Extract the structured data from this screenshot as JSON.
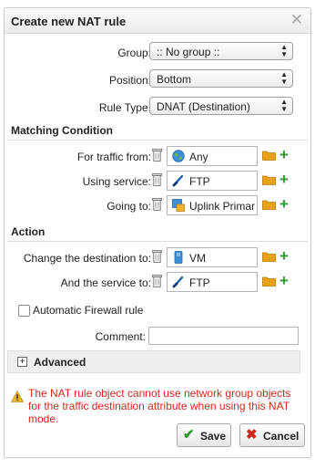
{
  "dialog": {
    "title": "Create new NAT rule"
  },
  "form": {
    "group": {
      "label": "Group:",
      "value": ":: No group ::"
    },
    "position": {
      "label": "Position:",
      "value": "Bottom"
    },
    "rule_type": {
      "label": "Rule Type:",
      "value": "DNAT (Destination)"
    }
  },
  "matching": {
    "heading": "Matching Condition",
    "traffic_from": {
      "label": "For traffic from:",
      "value": "Any",
      "icon": "globe-icon"
    },
    "service": {
      "label": "Using service:",
      "value": "FTP",
      "icon": "service-icon"
    },
    "going_to": {
      "label": "Going to:",
      "value": "Uplink Primar",
      "icon": "network-icon"
    }
  },
  "action": {
    "heading": "Action",
    "destination": {
      "label": "Change the destination to:",
      "value": "VM",
      "icon": "host-icon"
    },
    "service": {
      "label": "And the service to:",
      "value": "FTP",
      "icon": "service-icon"
    }
  },
  "auto_firewall": {
    "label": "Automatic Firewall rule",
    "checked": false
  },
  "comment": {
    "label": "Comment:",
    "value": ""
  },
  "advanced": {
    "label": "Advanced"
  },
  "warning": {
    "text": "The NAT rule object cannot use network group objects for the traffic destination attribute when using this NAT mode."
  },
  "buttons": {
    "save": "Save",
    "cancel": "Cancel"
  },
  "colors": {
    "accent_green": "#2a9b2a",
    "warning_red": "#cc2a1e",
    "folder_orange": "#e8a21a"
  }
}
